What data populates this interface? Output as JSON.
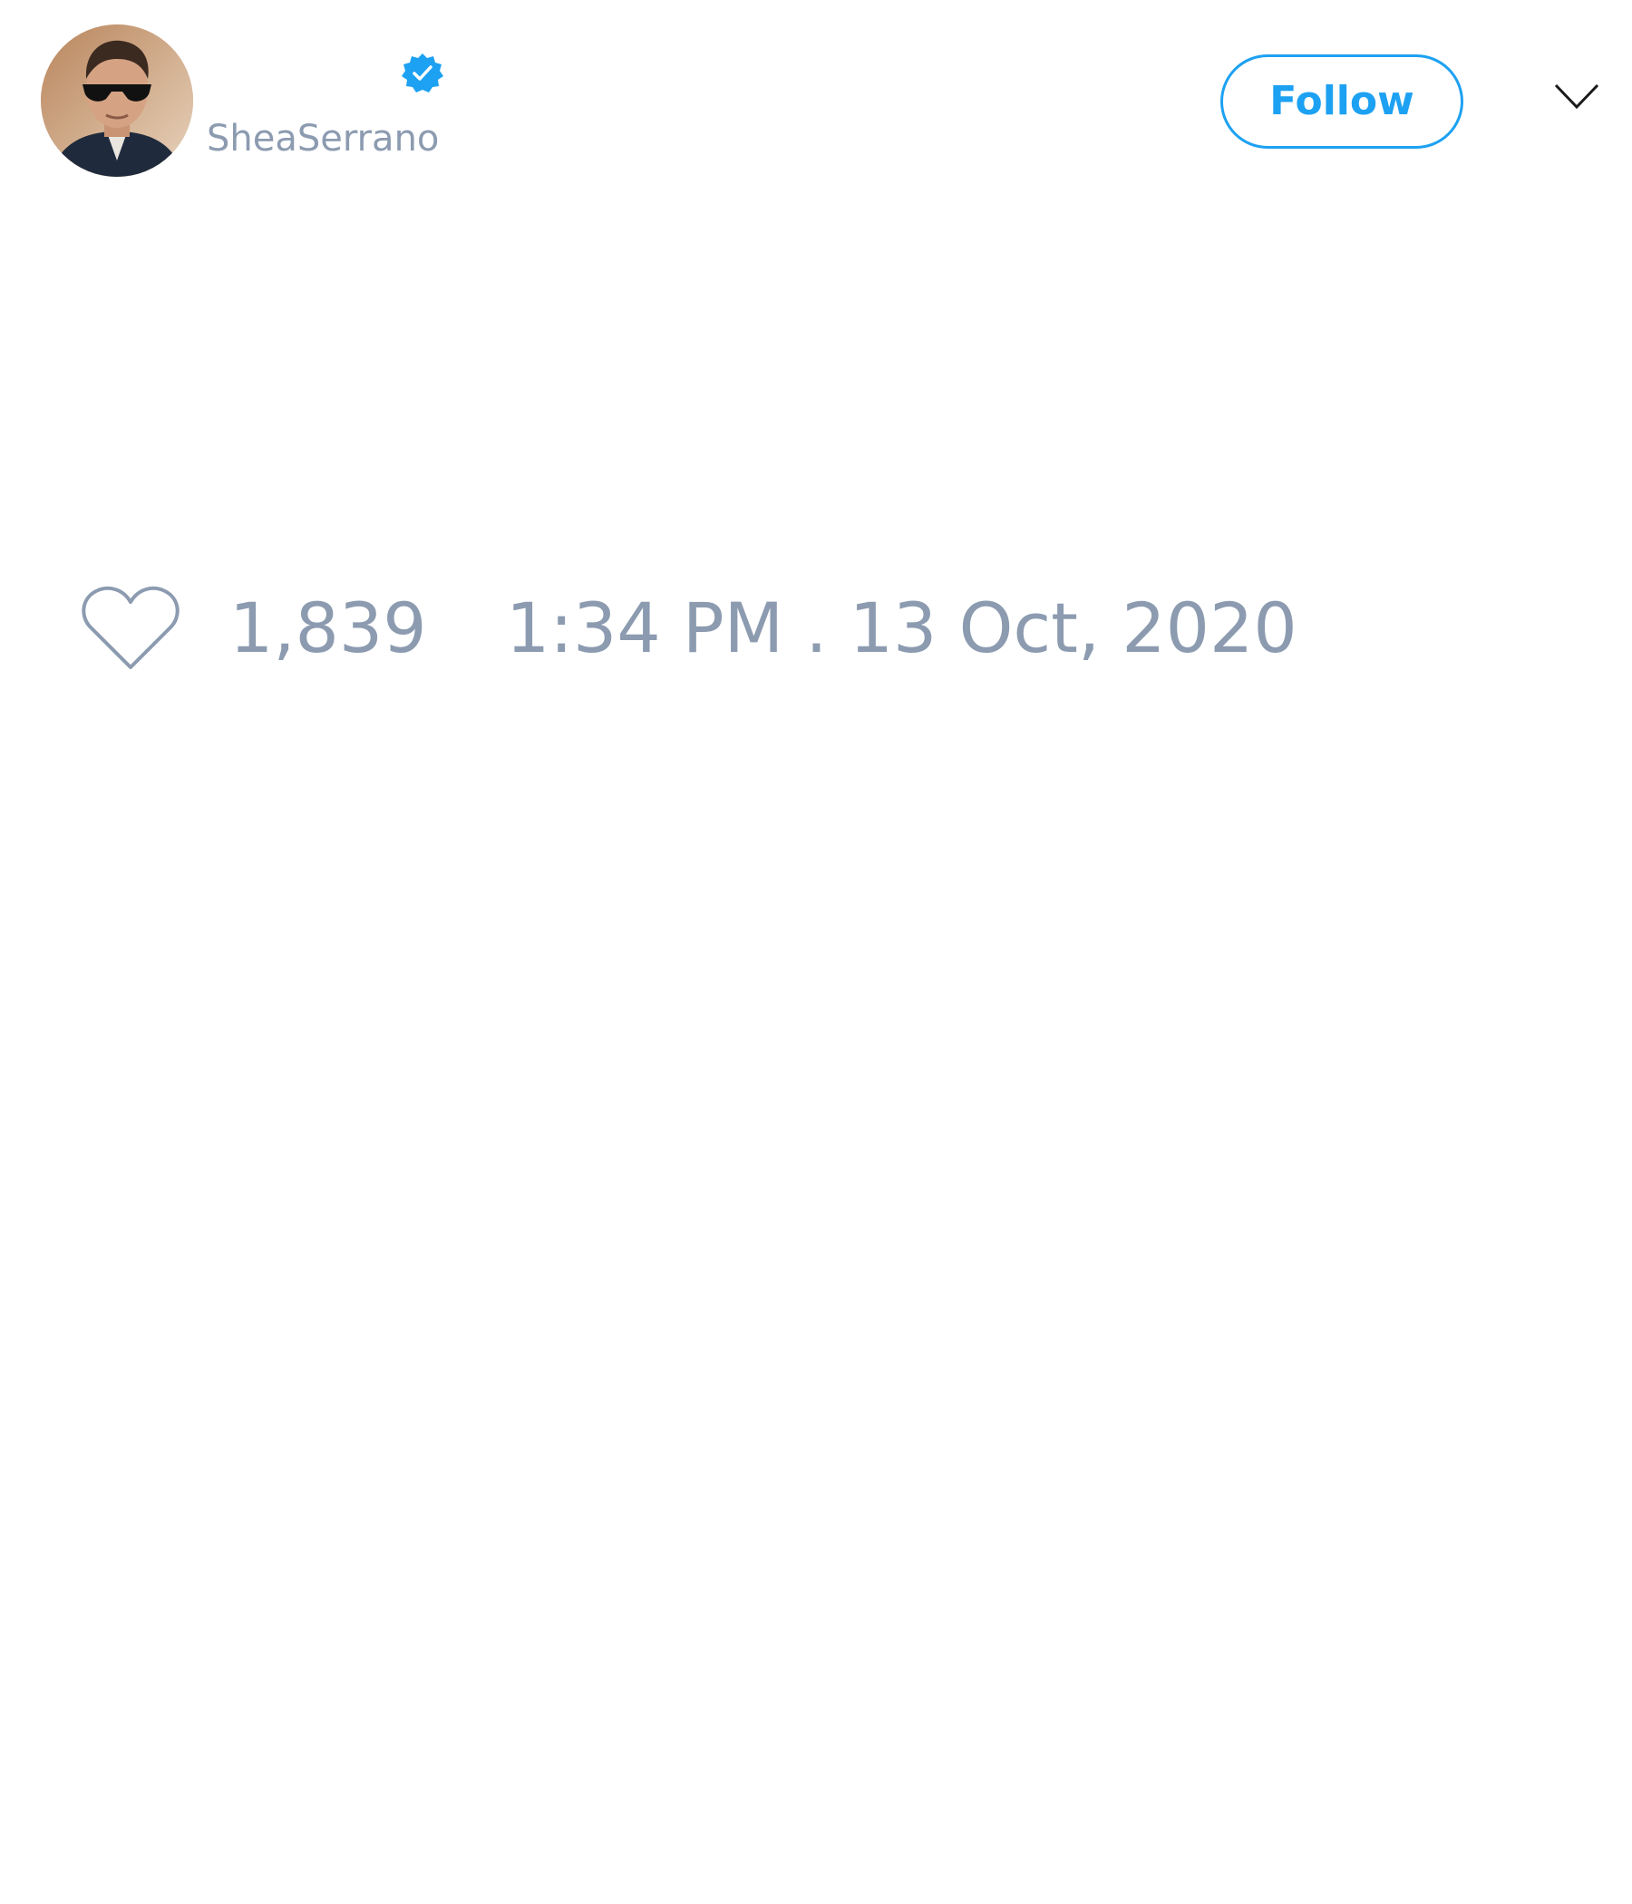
{
  "tweet": {
    "author": {
      "handle": "SheaSerrano",
      "verified": true,
      "avatar_icon": "profile-photo"
    },
    "follow_button_label": "Follow",
    "menu_icon": "chevron-down-icon",
    "like_icon": "heart-icon",
    "like_count": "1,839",
    "timestamp": "1:34 PM . 13 Oct, 2020"
  },
  "colors": {
    "accent": "#1da1f2",
    "muted_text": "#8c9bb0",
    "background": "#ffffff"
  }
}
